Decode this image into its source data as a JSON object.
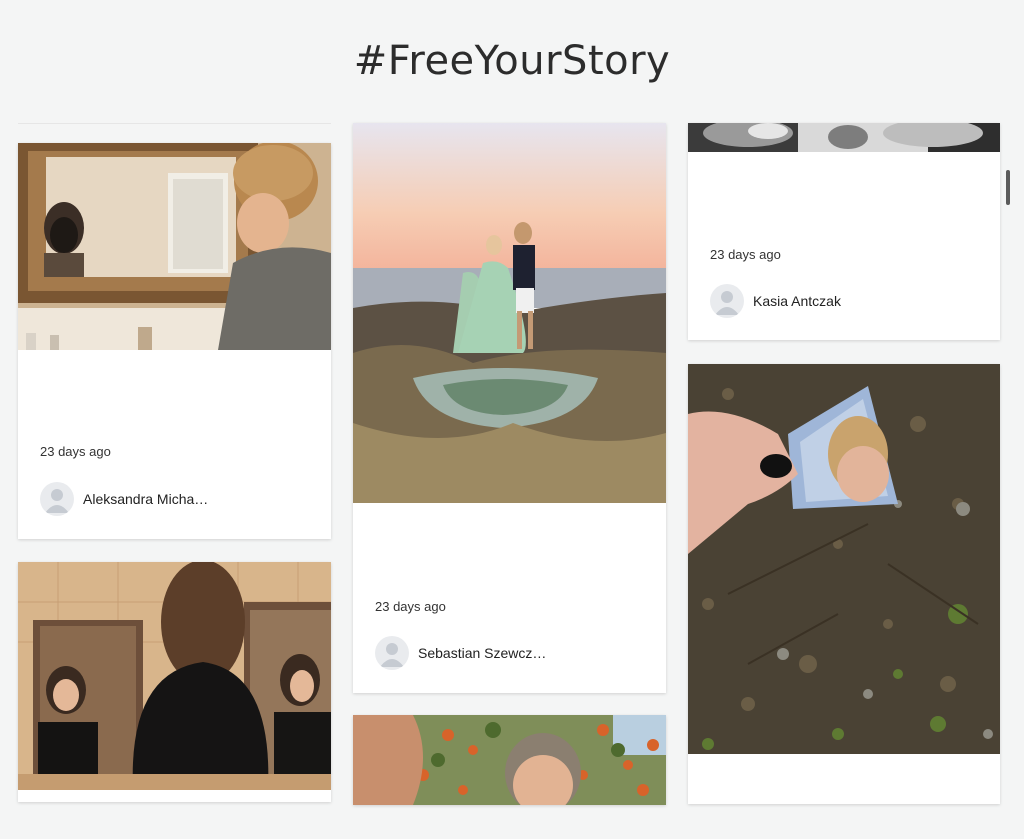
{
  "page": {
    "title": "#FreeYourStory"
  },
  "cards": [
    {
      "time": "23 days ago",
      "author": "Aleksandra Micha…",
      "photo": "woman-face-mask-mirror-photo"
    },
    {
      "time": "23 days ago",
      "author": "Sebastian Szewcz…",
      "photo": "couple-on-rocks-by-sea-photo"
    },
    {
      "time": "23 days ago",
      "author": "Kasia Antczak",
      "photo": "glassware-photo"
    },
    {
      "photo": "hand-holding-mirror-shard-photo"
    },
    {
      "photo": "woman-bathroom-mirrors-photo"
    },
    {
      "photo": "woman-portrait-autumn-tree-photo"
    }
  ],
  "colors": {
    "background": "#f4f5f5",
    "card": "#ffffff",
    "text": "#222222"
  }
}
